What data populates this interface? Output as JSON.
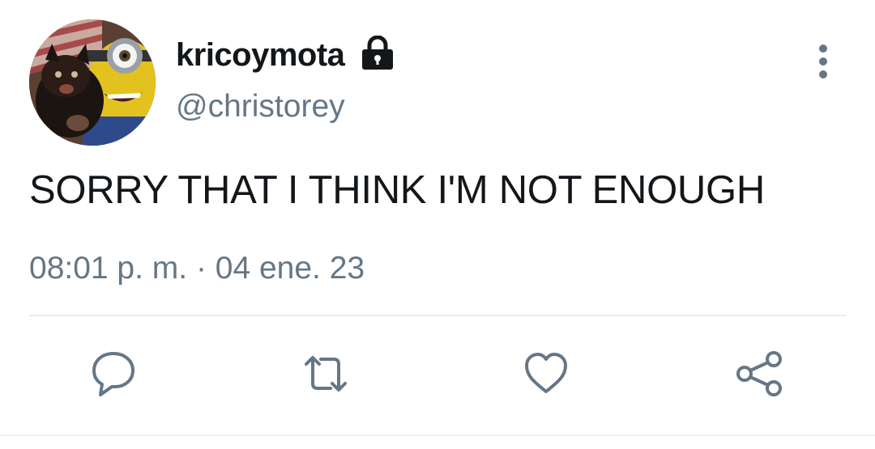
{
  "tweet": {
    "display_name": "kricoymota",
    "handle": "@christorey",
    "protected": true,
    "text": "SORRY THAT I THINK I'M NOT ENOUGH",
    "timestamp": "08:01 p. m. · 04 ene. 23"
  },
  "icons": {
    "lock": "lock-icon",
    "more": "more-vertical-icon",
    "reply": "reply-icon",
    "retweet": "retweet-icon",
    "like": "heart-icon",
    "share": "share-icon"
  },
  "colors": {
    "text_primary": "#14171a",
    "text_secondary": "#657786",
    "icon_gray": "#657786",
    "divider": "#e6ecf0"
  }
}
